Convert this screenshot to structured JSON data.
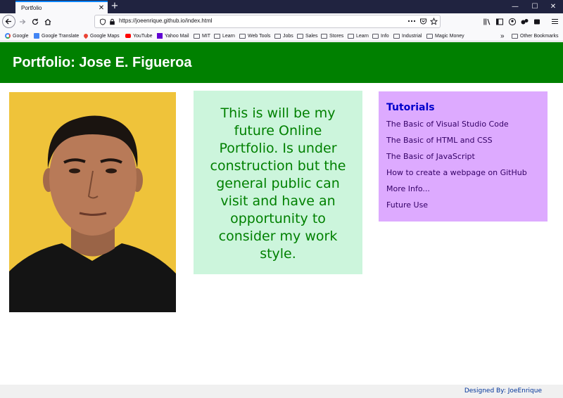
{
  "browser": {
    "tab_title": "Portfolio",
    "tab_close": "✕",
    "new_tab": "+",
    "url": "https://joeenrique.github.io/index.html",
    "window_controls": {
      "minimize": "—",
      "maximize": "☐",
      "close": "✕"
    }
  },
  "bookmarks": [
    {
      "label": "Google",
      "icon": "google-icon"
    },
    {
      "label": "Google Translate",
      "icon": "translate-icon"
    },
    {
      "label": "Google Maps",
      "icon": "maps-pin-icon"
    },
    {
      "label": "YouTube",
      "icon": "youtube-icon"
    },
    {
      "label": "Yahoo Mail",
      "icon": "yahoo-icon"
    },
    {
      "label": "MIT",
      "icon": "folder-icon"
    },
    {
      "label": "Learn",
      "icon": "folder-icon"
    },
    {
      "label": "Web Tools",
      "icon": "folder-icon"
    },
    {
      "label": "Jobs",
      "icon": "folder-icon"
    },
    {
      "label": "Sales",
      "icon": "folder-icon"
    },
    {
      "label": "Stores",
      "icon": "folder-icon"
    },
    {
      "label": "Learn",
      "icon": "folder-icon"
    },
    {
      "label": "Info",
      "icon": "folder-icon"
    },
    {
      "label": "Industrial",
      "icon": "folder-icon"
    },
    {
      "label": "Magic Money",
      "icon": "folder-icon"
    }
  ],
  "bookmarks_overflow": "»",
  "other_bookmarks": "Other Bookmarks",
  "page": {
    "header_title": "Portfolio: Jose E. Figueroa",
    "intro_text": "This is will be my future Online Portfolio. Is under construction but the general public can visit and have an opportunity to consider my work style.",
    "tutorials_heading": "Tutorials",
    "tutorial_links": [
      "The Basic of Visual Studio Code",
      "The Basic of HTML and CSS",
      "The Basic of JavaScript",
      "How to create a webpage on GitHub",
      "More Info...",
      "Future Use"
    ],
    "footer_text": "Designed By: JoeEnrique"
  },
  "colors": {
    "header_bg": "#008000",
    "intro_bg": "#ccf5dc",
    "intro_text": "#008000",
    "tutorials_bg": "#ddaaff",
    "tutorials_heading": "#0000cc",
    "photo_bg": "#efc33a"
  }
}
